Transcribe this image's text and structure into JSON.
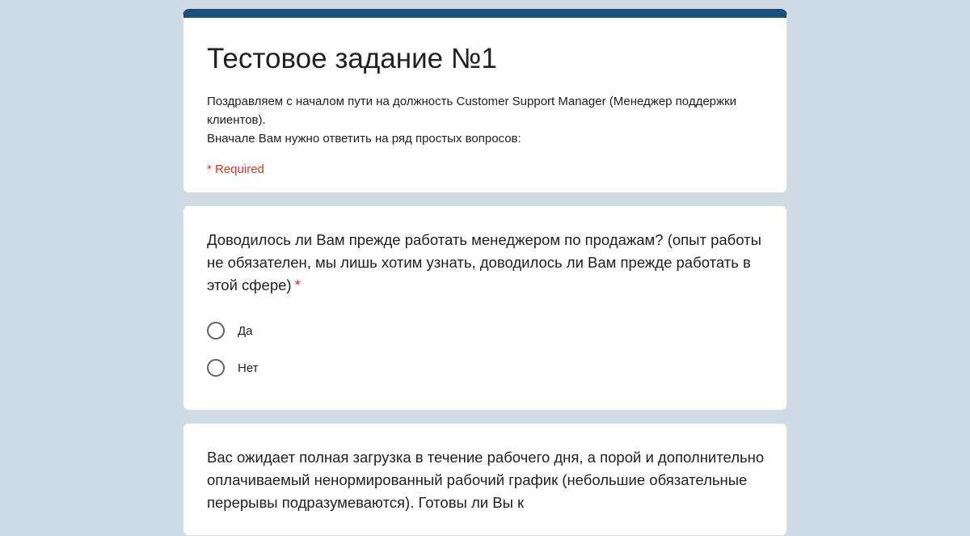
{
  "form": {
    "title": "Тестовое задание №1",
    "description": "Поздравляем с началом пути на должность Customer Support Manager (Менеджер поддержки клиентов).\nВначале Вам нужно ответить на ряд простых вопросов:",
    "required_note": "* Required",
    "accent_color": "#1b4f7a",
    "background_color": "#d0dce5"
  },
  "questions": [
    {
      "title": "Доводилось ли Вам прежде работать менеджером по продажам? (опыт работы не обязателен, мы лишь хотим узнать, доводилось ли Вам прежде работать в этой сфере)",
      "required_mark": "*",
      "options": [
        {
          "label": "Да",
          "icon": "radio-unchecked-icon"
        },
        {
          "label": "Нет",
          "icon": "radio-unchecked-icon"
        }
      ]
    },
    {
      "title": "Вас ожидает полная загрузка в течение рабочего дня, а порой и дополнительно оплачиваемый ненормированный рабочий график (небольшие обязательные перерывы подразумеваются). Готовы ли Вы к"
    }
  ]
}
